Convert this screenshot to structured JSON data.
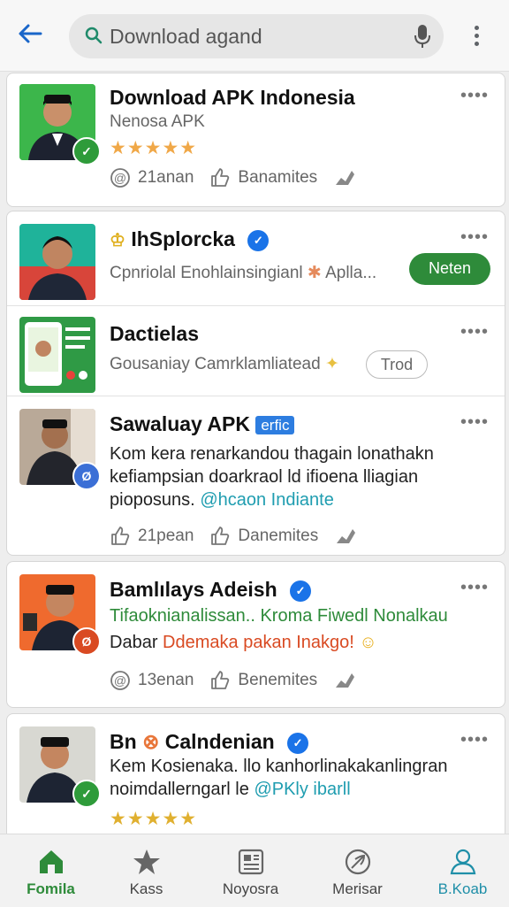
{
  "search": {
    "query": "Download agand"
  },
  "colors": {
    "accent": "#1a73e8",
    "green": "#2e8b3a",
    "star": "#f0a848"
  },
  "posts": [
    {
      "title": "Download APK Indonesia",
      "subtitle": "Nenosa APK",
      "stars": "★★★★★",
      "action1": "21anan",
      "action2": "Banamites"
    },
    {
      "title": "IhSplorcka",
      "subtitle": "Cpnriolal Enohlainsingianl",
      "subtitle2": "Aplla...",
      "button": "Neten"
    },
    {
      "title": "Dactielas",
      "subtitle": "Gousaniay Camrklamliatead",
      "button": "Trod"
    },
    {
      "title": "Sawaluay APK",
      "tag": "erfic",
      "line1": "Kom kera renarkandou thagain lonathakn",
      "line2": "kefiampsian doarkraol ld ifioena lliagian",
      "line3a": "pioposuns.",
      "line3b": "@hcaon Indiante",
      "action1": "21pean",
      "action2": "Danemites"
    },
    {
      "title": "Bamlılays Adeish",
      "line1": "Tifaoknianalissan.. Kroma Fiwedl Nonalkau",
      "line2a": "Dabar",
      "line2b": "Ddemaka pakan Inakgo!",
      "action1": "13enan",
      "action2": "Benemites"
    },
    {
      "title": "Bn",
      "title2": "Calndenian",
      "line1": "Kem Kosienaka. llo kanhorlinakakanlingran",
      "line2a": "noimdallerngarl le",
      "line2b": "@PKly ibarll",
      "stars": "★★★★★"
    }
  ],
  "nav": [
    {
      "label": "Fomila",
      "icon": "home-icon",
      "active": true
    },
    {
      "label": "Kass",
      "icon": "star-icon"
    },
    {
      "label": "Noyosra",
      "icon": "news-icon"
    },
    {
      "label": "Merisar",
      "icon": "leaf-icon"
    },
    {
      "label": "B.Koab",
      "icon": "person-icon"
    }
  ]
}
